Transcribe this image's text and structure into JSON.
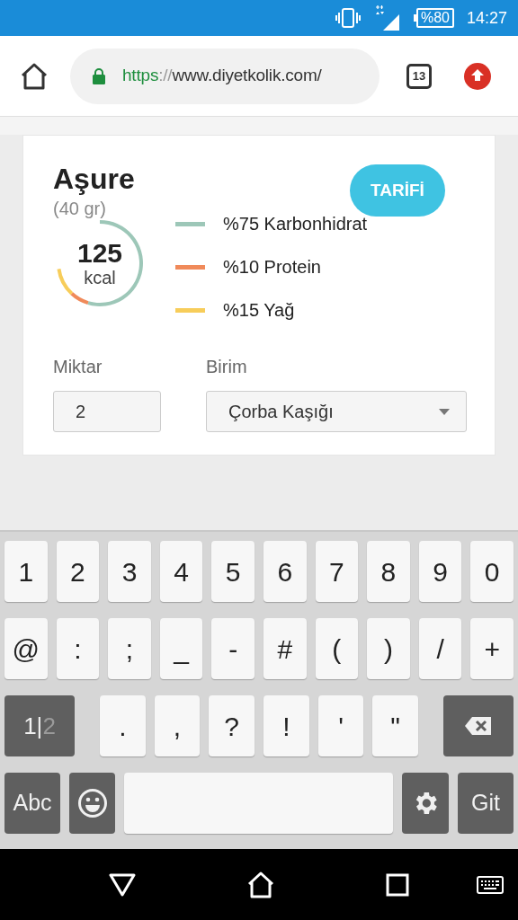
{
  "status_bar": {
    "battery": "%80",
    "time": "14:27"
  },
  "browser": {
    "url_scheme": "https",
    "url_separator": "://",
    "url_rest": "www.diyetkolik.com/",
    "tab_count": "13"
  },
  "food": {
    "title": "Aşure",
    "portion": "(40 gr)",
    "recipe_button": "TARİFİ",
    "calories": "125",
    "calories_unit": "kcal",
    "macros": [
      {
        "label": "%75 Karbonhidrat",
        "color": "#9dc7b8"
      },
      {
        "label": "%10 Protein",
        "color": "#f08a5a"
      },
      {
        "label": "%15 Yağ",
        "color": "#f7cd5a"
      }
    ],
    "chart_data": {
      "type": "donut",
      "values": [
        75,
        10,
        15
      ]
    },
    "amount_label": "Miktar",
    "amount_value": "2",
    "unit_label": "Birim",
    "unit_value": "Çorba Kaşığı"
  },
  "keyboard": {
    "rows": [
      {
        "keys": [
          {
            "kind": "char",
            "label": "1"
          },
          {
            "kind": "char",
            "label": "2"
          },
          {
            "kind": "char",
            "label": "3"
          },
          {
            "kind": "char",
            "label": "4"
          },
          {
            "kind": "char",
            "label": "5"
          },
          {
            "kind": "char",
            "label": "6"
          },
          {
            "kind": "char",
            "label": "7"
          },
          {
            "kind": "char",
            "label": "8"
          },
          {
            "kind": "char",
            "label": "9"
          },
          {
            "kind": "char",
            "label": "0"
          }
        ]
      },
      {
        "keys": [
          {
            "kind": "char",
            "label": "@"
          },
          {
            "kind": "char",
            "label": ":"
          },
          {
            "kind": "char",
            "label": ";"
          },
          {
            "kind": "char",
            "label": "_"
          },
          {
            "kind": "char",
            "label": "-"
          },
          {
            "kind": "char",
            "label": "#"
          },
          {
            "kind": "char",
            "label": "("
          },
          {
            "kind": "char",
            "label": ")"
          },
          {
            "kind": "char",
            "label": "/"
          },
          {
            "kind": "char",
            "label": "+"
          }
        ]
      },
      {
        "keys": [
          {
            "kind": "page",
            "current": "1",
            "separator": "|",
            "other": "2"
          },
          {
            "kind": "char",
            "label": "."
          },
          {
            "kind": "char",
            "label": ","
          },
          {
            "kind": "char",
            "label": "?"
          },
          {
            "kind": "char",
            "label": "!"
          },
          {
            "kind": "char",
            "label": "'"
          },
          {
            "kind": "char",
            "label": "\""
          },
          {
            "kind": "backspace"
          }
        ]
      },
      {
        "keys": [
          {
            "kind": "mode",
            "label": "Abc"
          },
          {
            "kind": "emoji"
          },
          {
            "kind": "space"
          },
          {
            "kind": "settings"
          },
          {
            "kind": "mode",
            "label": "Git"
          }
        ]
      }
    ]
  }
}
